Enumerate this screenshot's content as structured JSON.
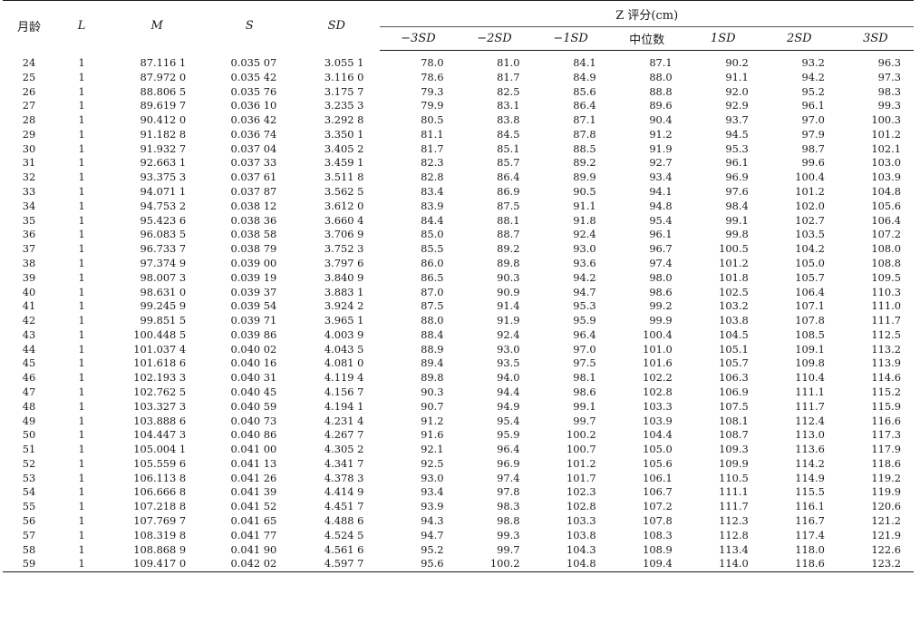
{
  "header": {
    "age": "月龄",
    "L": "L",
    "M": "M",
    "S": "S",
    "SD": "SD",
    "z_group": "Z 评分(cm)",
    "z_cols": [
      "−3SD",
      "−2SD",
      "−1SD",
      "中位数",
      "1SD",
      "2SD",
      "3SD"
    ]
  },
  "rows": [
    [
      "24",
      "1",
      "87.116 1",
      "0.035 07",
      "3.055 1",
      "78.0",
      "81.0",
      "84.1",
      "87.1",
      "90.2",
      "93.2",
      "96.3"
    ],
    [
      "25",
      "1",
      "87.972 0",
      "0.035 42",
      "3.116 0",
      "78.6",
      "81.7",
      "84.9",
      "88.0",
      "91.1",
      "94.2",
      "97.3"
    ],
    [
      "26",
      "1",
      "88.806 5",
      "0.035 76",
      "3.175 7",
      "79.3",
      "82.5",
      "85.6",
      "88.8",
      "92.0",
      "95.2",
      "98.3"
    ],
    [
      "27",
      "1",
      "89.619 7",
      "0.036 10",
      "3.235 3",
      "79.9",
      "83.1",
      "86.4",
      "89.6",
      "92.9",
      "96.1",
      "99.3"
    ],
    [
      "28",
      "1",
      "90.412 0",
      "0.036 42",
      "3.292 8",
      "80.5",
      "83.8",
      "87.1",
      "90.4",
      "93.7",
      "97.0",
      "100.3"
    ],
    [
      "29",
      "1",
      "91.182 8",
      "0.036 74",
      "3.350 1",
      "81.1",
      "84.5",
      "87.8",
      "91.2",
      "94.5",
      "97.9",
      "101.2"
    ],
    [
      "30",
      "1",
      "91.932 7",
      "0.037 04",
      "3.405 2",
      "81.7",
      "85.1",
      "88.5",
      "91.9",
      "95.3",
      "98.7",
      "102.1"
    ],
    [
      "31",
      "1",
      "92.663 1",
      "0.037 33",
      "3.459 1",
      "82.3",
      "85.7",
      "89.2",
      "92.7",
      "96.1",
      "99.6",
      "103.0"
    ],
    [
      "32",
      "1",
      "93.375 3",
      "0.037 61",
      "3.511 8",
      "82.8",
      "86.4",
      "89.9",
      "93.4",
      "96.9",
      "100.4",
      "103.9"
    ],
    [
      "33",
      "1",
      "94.071 1",
      "0.037 87",
      "3.562 5",
      "83.4",
      "86.9",
      "90.5",
      "94.1",
      "97.6",
      "101.2",
      "104.8"
    ],
    [
      "34",
      "1",
      "94.753 2",
      "0.038 12",
      "3.612 0",
      "83.9",
      "87.5",
      "91.1",
      "94.8",
      "98.4",
      "102.0",
      "105.6"
    ],
    [
      "35",
      "1",
      "95.423 6",
      "0.038 36",
      "3.660 4",
      "84.4",
      "88.1",
      "91.8",
      "95.4",
      "99.1",
      "102.7",
      "106.4"
    ],
    [
      "36",
      "1",
      "96.083 5",
      "0.038 58",
      "3.706 9",
      "85.0",
      "88.7",
      "92.4",
      "96.1",
      "99.8",
      "103.5",
      "107.2"
    ],
    [
      "37",
      "1",
      "96.733 7",
      "0.038 79",
      "3.752 3",
      "85.5",
      "89.2",
      "93.0",
      "96.7",
      "100.5",
      "104.2",
      "108.0"
    ],
    [
      "38",
      "1",
      "97.374 9",
      "0.039 00",
      "3.797 6",
      "86.0",
      "89.8",
      "93.6",
      "97.4",
      "101.2",
      "105.0",
      "108.8"
    ],
    [
      "39",
      "1",
      "98.007 3",
      "0.039 19",
      "3.840 9",
      "86.5",
      "90.3",
      "94.2",
      "98.0",
      "101.8",
      "105.7",
      "109.5"
    ],
    [
      "40",
      "1",
      "98.631 0",
      "0.039 37",
      "3.883 1",
      "87.0",
      "90.9",
      "94.7",
      "98.6",
      "102.5",
      "106.4",
      "110.3"
    ],
    [
      "41",
      "1",
      "99.245 9",
      "0.039 54",
      "3.924 2",
      "87.5",
      "91.4",
      "95.3",
      "99.2",
      "103.2",
      "107.1",
      "111.0"
    ],
    [
      "42",
      "1",
      "99.851 5",
      "0.039 71",
      "3.965 1",
      "88.0",
      "91.9",
      "95.9",
      "99.9",
      "103.8",
      "107.8",
      "111.7"
    ],
    [
      "43",
      "1",
      "100.448 5",
      "0.039 86",
      "4.003 9",
      "88.4",
      "92.4",
      "96.4",
      "100.4",
      "104.5",
      "108.5",
      "112.5"
    ],
    [
      "44",
      "1",
      "101.037 4",
      "0.040 02",
      "4.043 5",
      "88.9",
      "93.0",
      "97.0",
      "101.0",
      "105.1",
      "109.1",
      "113.2"
    ],
    [
      "45",
      "1",
      "101.618 6",
      "0.040 16",
      "4.081 0",
      "89.4",
      "93.5",
      "97.5",
      "101.6",
      "105.7",
      "109.8",
      "113.9"
    ],
    [
      "46",
      "1",
      "102.193 3",
      "0.040 31",
      "4.119 4",
      "89.8",
      "94.0",
      "98.1",
      "102.2",
      "106.3",
      "110.4",
      "114.6"
    ],
    [
      "47",
      "1",
      "102.762 5",
      "0.040 45",
      "4.156 7",
      "90.3",
      "94.4",
      "98.6",
      "102.8",
      "106.9",
      "111.1",
      "115.2"
    ],
    [
      "48",
      "1",
      "103.327 3",
      "0.040 59",
      "4.194 1",
      "90.7",
      "94.9",
      "99.1",
      "103.3",
      "107.5",
      "111.7",
      "115.9"
    ],
    [
      "49",
      "1",
      "103.888 6",
      "0.040 73",
      "4.231 4",
      "91.2",
      "95.4",
      "99.7",
      "103.9",
      "108.1",
      "112.4",
      "116.6"
    ],
    [
      "50",
      "1",
      "104.447 3",
      "0.040 86",
      "4.267 7",
      "91.6",
      "95.9",
      "100.2",
      "104.4",
      "108.7",
      "113.0",
      "117.3"
    ],
    [
      "51",
      "1",
      "105.004 1",
      "0.041 00",
      "4.305 2",
      "92.1",
      "96.4",
      "100.7",
      "105.0",
      "109.3",
      "113.6",
      "117.9"
    ],
    [
      "52",
      "1",
      "105.559 6",
      "0.041 13",
      "4.341 7",
      "92.5",
      "96.9",
      "101.2",
      "105.6",
      "109.9",
      "114.2",
      "118.6"
    ],
    [
      "53",
      "1",
      "106.113 8",
      "0.041 26",
      "4.378 3",
      "93.0",
      "97.4",
      "101.7",
      "106.1",
      "110.5",
      "114.9",
      "119.2"
    ],
    [
      "54",
      "1",
      "106.666 8",
      "0.041 39",
      "4.414 9",
      "93.4",
      "97.8",
      "102.3",
      "106.7",
      "111.1",
      "115.5",
      "119.9"
    ],
    [
      "55",
      "1",
      "107.218 8",
      "0.041 52",
      "4.451 7",
      "93.9",
      "98.3",
      "102.8",
      "107.2",
      "111.7",
      "116.1",
      "120.6"
    ],
    [
      "56",
      "1",
      "107.769 7",
      "0.041 65",
      "4.488 6",
      "94.3",
      "98.8",
      "103.3",
      "107.8",
      "112.3",
      "116.7",
      "121.2"
    ],
    [
      "57",
      "1",
      "108.319 8",
      "0.041 77",
      "4.524 5",
      "94.7",
      "99.3",
      "103.8",
      "108.3",
      "112.8",
      "117.4",
      "121.9"
    ],
    [
      "58",
      "1",
      "108.868 9",
      "0.041 90",
      "4.561 6",
      "95.2",
      "99.7",
      "104.3",
      "108.9",
      "113.4",
      "118.0",
      "122.6"
    ],
    [
      "59",
      "1",
      "109.417 0",
      "0.042 02",
      "4.597 7",
      "95.6",
      "100.2",
      "104.8",
      "109.4",
      "114.0",
      "118.6",
      "123.2"
    ]
  ]
}
